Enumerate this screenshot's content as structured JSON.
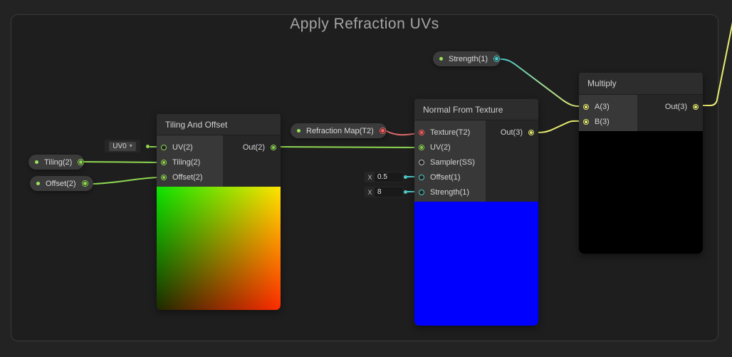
{
  "frame": {
    "title": "Apply Refraction UVs"
  },
  "icons": {
    "dropdown_caret": "▾"
  },
  "colors": {
    "vector2_green": "#8FD752",
    "texture_red": "#FF6161",
    "float_teal": "#4EC9C9",
    "vector3_yellow": "#E9ED6F",
    "property_dot_green": "#9BE35B",
    "preview_blue": "#0000FF",
    "preview_black": "#000000",
    "node_header_bg": "#2D2D2D",
    "canvas_bg": "#232323"
  },
  "properties": {
    "tiling": {
      "label": "Tiling(2)"
    },
    "offset": {
      "label": "Offset(2)"
    },
    "refraction_map": {
      "label": "Refraction Map(T2)"
    },
    "strength": {
      "label": "Strength(1)"
    }
  },
  "widgets": {
    "uv_channel": {
      "value": "UV0"
    },
    "offset_default": {
      "axis_label": "X",
      "value": "0.5"
    },
    "strength_default": {
      "axis_label": "X",
      "value": "8"
    }
  },
  "nodes": {
    "tiling_and_offset": {
      "title": "Tiling And Offset",
      "inputs": [
        {
          "label": "UV(2)"
        },
        {
          "label": "Tiling(2)"
        },
        {
          "label": "Offset(2)"
        }
      ],
      "outputs": [
        {
          "label": "Out(2)"
        }
      ]
    },
    "normal_from_texture": {
      "title": "Normal From Texture",
      "inputs": [
        {
          "label": "Texture(T2)"
        },
        {
          "label": "UV(2)"
        },
        {
          "label": "Sampler(SS)"
        },
        {
          "label": "Offset(1)"
        },
        {
          "label": "Strength(1)"
        }
      ],
      "outputs": [
        {
          "label": "Out(3)"
        }
      ]
    },
    "multiply": {
      "title": "Multiply",
      "inputs": [
        {
          "label": "A(3)"
        },
        {
          "label": "B(3)"
        }
      ],
      "outputs": [
        {
          "label": "Out(3)"
        }
      ]
    }
  },
  "connections": [
    {
      "from": "UV0 channel default",
      "to": "Tiling And Offset.UV(2)"
    },
    {
      "from": "Tiling(2) property",
      "to": "Tiling And Offset.Tiling(2)"
    },
    {
      "from": "Offset(2) property",
      "to": "Tiling And Offset.Offset(2)"
    },
    {
      "from": "Tiling And Offset.Out(2)",
      "to": "Normal From Texture.UV(2)"
    },
    {
      "from": "Refraction Map(T2) property",
      "to": "Normal From Texture.Texture(T2)"
    },
    {
      "from": "Strength(1) property",
      "to": "Multiply.A(3)"
    },
    {
      "from": "Normal From Texture.Out(3)",
      "to": "Multiply.B(3)"
    },
    {
      "from": "Multiply.Out(3)",
      "to": "off-screen (top right)"
    }
  ]
}
